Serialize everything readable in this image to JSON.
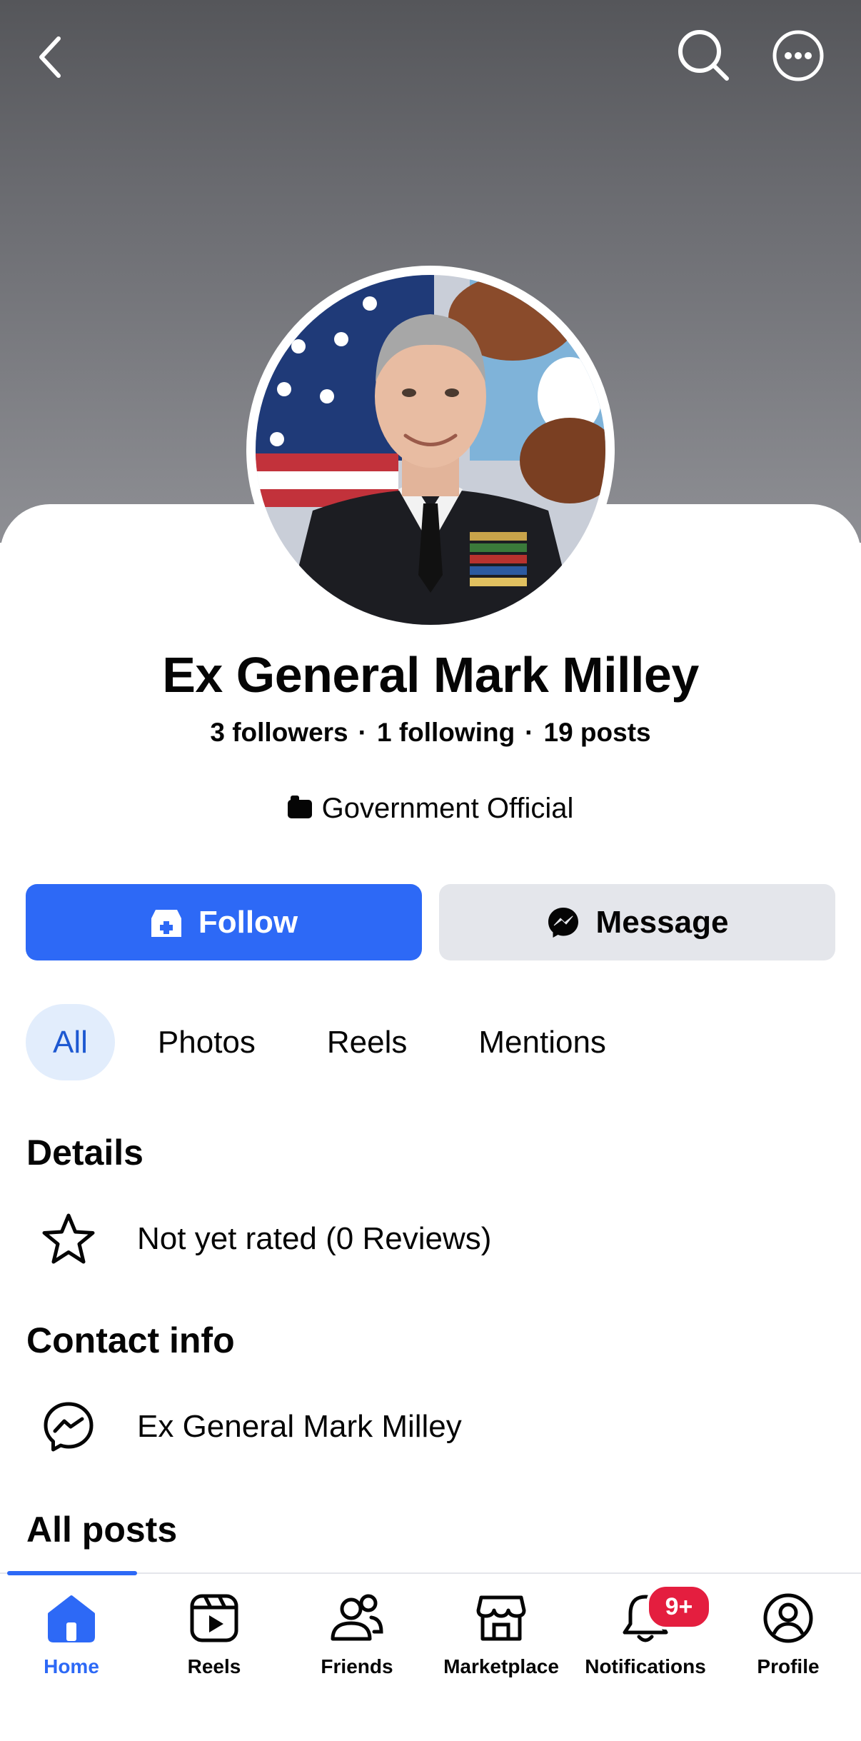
{
  "profile": {
    "name": "Ex General Mark Milley",
    "followers": "3 followers",
    "following": "1 following",
    "posts": "19 posts",
    "category": "Government Official"
  },
  "actions": {
    "follow_label": "Follow",
    "message_label": "Message"
  },
  "filters": [
    "All",
    "Photos",
    "Reels",
    "Mentions"
  ],
  "details": {
    "title": "Details",
    "rating_text": "Not yet rated (0 Reviews)"
  },
  "contact": {
    "title": "Contact info",
    "messenger_name": "Ex General Mark Milley"
  },
  "posts_title": "All posts",
  "tabbar": {
    "items": [
      {
        "label": "Home",
        "icon": "home-icon"
      },
      {
        "label": "Reels",
        "icon": "reels-icon"
      },
      {
        "label": "Friends",
        "icon": "friends-icon"
      },
      {
        "label": "Marketplace",
        "icon": "marketplace-icon"
      },
      {
        "label": "Notifications",
        "icon": "bell-icon"
      },
      {
        "label": "Profile",
        "icon": "profile-icon"
      }
    ],
    "notification_badge": "9+"
  },
  "colors": {
    "accent": "#2d69f6",
    "badge": "#e41e3f",
    "chip_active_bg": "#e2edfc"
  }
}
